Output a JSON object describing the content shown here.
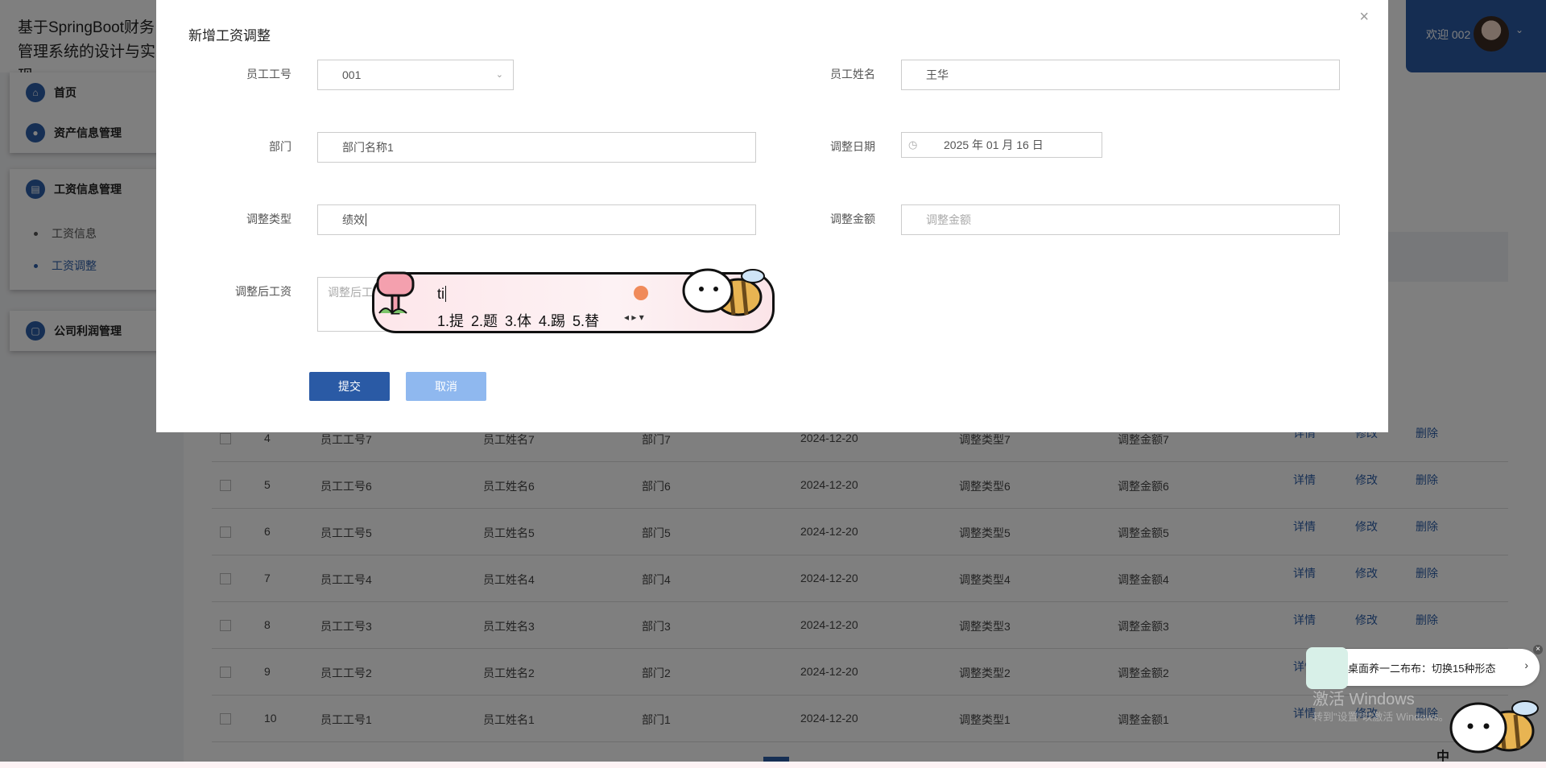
{
  "app": {
    "title": "基于SpringBoot财务管理系统的设计与实现",
    "welcome": "欢迎 002"
  },
  "sidebar": {
    "items": [
      {
        "label": "首页",
        "icon": "home-icon"
      },
      {
        "label": "资产信息管理",
        "icon": "drop-icon"
      },
      {
        "label": "工资信息管理",
        "icon": "document-icon"
      },
      {
        "label": "公司利润管理",
        "icon": "clipboard-icon"
      }
    ],
    "sub_items": [
      {
        "label": "工资信息"
      },
      {
        "label": "工资调整"
      }
    ]
  },
  "table": {
    "rows": [
      {
        "idx": "4",
        "emp_no": "员工工号7",
        "name": "员工姓名7",
        "dept": "部门7",
        "date": "2024-12-20",
        "type": "调整类型7",
        "amount": "调整金额7"
      },
      {
        "idx": "5",
        "emp_no": "员工工号6",
        "name": "员工姓名6",
        "dept": "部门6",
        "date": "2024-12-20",
        "type": "调整类型6",
        "amount": "调整金额6"
      },
      {
        "idx": "6",
        "emp_no": "员工工号5",
        "name": "员工姓名5",
        "dept": "部门5",
        "date": "2024-12-20",
        "type": "调整类型5",
        "amount": "调整金额5"
      },
      {
        "idx": "7",
        "emp_no": "员工工号4",
        "name": "员工姓名4",
        "dept": "部门4",
        "date": "2024-12-20",
        "type": "调整类型4",
        "amount": "调整金额4"
      },
      {
        "idx": "8",
        "emp_no": "员工工号3",
        "name": "员工姓名3",
        "dept": "部门3",
        "date": "2024-12-20",
        "type": "调整类型3",
        "amount": "调整金额3"
      },
      {
        "idx": "9",
        "emp_no": "员工工号2",
        "name": "员工姓名2",
        "dept": "部门2",
        "date": "2024-12-20",
        "type": "调整类型2",
        "amount": "调整金额2"
      },
      {
        "idx": "10",
        "emp_no": "员工工号1",
        "name": "员工姓名1",
        "dept": "部门1",
        "date": "2024-12-20",
        "type": "调整类型1",
        "amount": "调整金额1"
      }
    ],
    "actions": {
      "detail": "详情",
      "edit": "修改",
      "delete": "删除"
    }
  },
  "dialog": {
    "title": "新增工资调整",
    "close": "×",
    "fields": {
      "emp_no": {
        "label": "员工工号",
        "value": "001"
      },
      "emp_name": {
        "label": "员工姓名",
        "value": "王华"
      },
      "dept": {
        "label": "部门",
        "value": "部门名称1"
      },
      "adjust_date": {
        "label": "调整日期",
        "value": "2025 年 01 月 16 日"
      },
      "adjust_type": {
        "label": "调整类型",
        "value": "绩效"
      },
      "adjust_amount": {
        "label": "调整金额",
        "placeholder": "调整金额"
      },
      "salary_after": {
        "label": "调整后工资",
        "placeholder": "调整后工"
      }
    },
    "submit": "提交",
    "cancel": "取消"
  },
  "ime": {
    "input": "ti",
    "candidates": "1.提  2.题  3.体  4.踢  5.替"
  },
  "desktop": {
    "activate_title": "激活 Windows",
    "activate_sub": "转到\"设置\"以激活 Windows。",
    "toast_text": "桌面养一二布布：切换15种形态",
    "ime_indicator": "中"
  }
}
